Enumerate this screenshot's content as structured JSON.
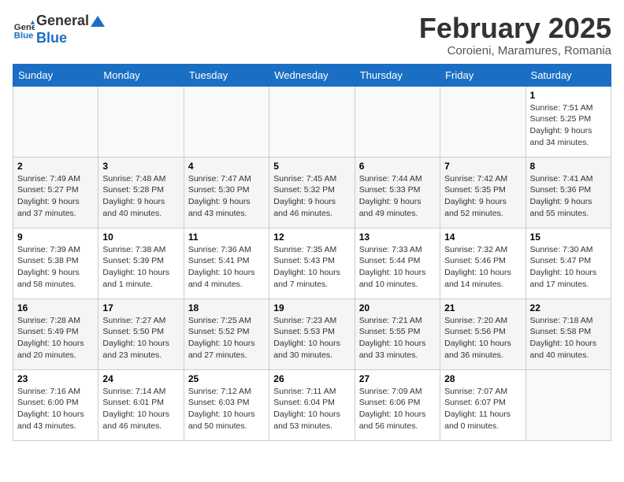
{
  "header": {
    "logo_general": "General",
    "logo_blue": "Blue",
    "month_title": "February 2025",
    "subtitle": "Coroieni, Maramures, Romania"
  },
  "days_of_week": [
    "Sunday",
    "Monday",
    "Tuesday",
    "Wednesday",
    "Thursday",
    "Friday",
    "Saturday"
  ],
  "weeks": [
    [
      {
        "day": "",
        "info": ""
      },
      {
        "day": "",
        "info": ""
      },
      {
        "day": "",
        "info": ""
      },
      {
        "day": "",
        "info": ""
      },
      {
        "day": "",
        "info": ""
      },
      {
        "day": "",
        "info": ""
      },
      {
        "day": "1",
        "info": "Sunrise: 7:51 AM\nSunset: 5:25 PM\nDaylight: 9 hours\nand 34 minutes."
      }
    ],
    [
      {
        "day": "2",
        "info": "Sunrise: 7:49 AM\nSunset: 5:27 PM\nDaylight: 9 hours\nand 37 minutes."
      },
      {
        "day": "3",
        "info": "Sunrise: 7:48 AM\nSunset: 5:28 PM\nDaylight: 9 hours\nand 40 minutes."
      },
      {
        "day": "4",
        "info": "Sunrise: 7:47 AM\nSunset: 5:30 PM\nDaylight: 9 hours\nand 43 minutes."
      },
      {
        "day": "5",
        "info": "Sunrise: 7:45 AM\nSunset: 5:32 PM\nDaylight: 9 hours\nand 46 minutes."
      },
      {
        "day": "6",
        "info": "Sunrise: 7:44 AM\nSunset: 5:33 PM\nDaylight: 9 hours\nand 49 minutes."
      },
      {
        "day": "7",
        "info": "Sunrise: 7:42 AM\nSunset: 5:35 PM\nDaylight: 9 hours\nand 52 minutes."
      },
      {
        "day": "8",
        "info": "Sunrise: 7:41 AM\nSunset: 5:36 PM\nDaylight: 9 hours\nand 55 minutes."
      }
    ],
    [
      {
        "day": "9",
        "info": "Sunrise: 7:39 AM\nSunset: 5:38 PM\nDaylight: 9 hours\nand 58 minutes."
      },
      {
        "day": "10",
        "info": "Sunrise: 7:38 AM\nSunset: 5:39 PM\nDaylight: 10 hours\nand 1 minute."
      },
      {
        "day": "11",
        "info": "Sunrise: 7:36 AM\nSunset: 5:41 PM\nDaylight: 10 hours\nand 4 minutes."
      },
      {
        "day": "12",
        "info": "Sunrise: 7:35 AM\nSunset: 5:43 PM\nDaylight: 10 hours\nand 7 minutes."
      },
      {
        "day": "13",
        "info": "Sunrise: 7:33 AM\nSunset: 5:44 PM\nDaylight: 10 hours\nand 10 minutes."
      },
      {
        "day": "14",
        "info": "Sunrise: 7:32 AM\nSunset: 5:46 PM\nDaylight: 10 hours\nand 14 minutes."
      },
      {
        "day": "15",
        "info": "Sunrise: 7:30 AM\nSunset: 5:47 PM\nDaylight: 10 hours\nand 17 minutes."
      }
    ],
    [
      {
        "day": "16",
        "info": "Sunrise: 7:28 AM\nSunset: 5:49 PM\nDaylight: 10 hours\nand 20 minutes."
      },
      {
        "day": "17",
        "info": "Sunrise: 7:27 AM\nSunset: 5:50 PM\nDaylight: 10 hours\nand 23 minutes."
      },
      {
        "day": "18",
        "info": "Sunrise: 7:25 AM\nSunset: 5:52 PM\nDaylight: 10 hours\nand 27 minutes."
      },
      {
        "day": "19",
        "info": "Sunrise: 7:23 AM\nSunset: 5:53 PM\nDaylight: 10 hours\nand 30 minutes."
      },
      {
        "day": "20",
        "info": "Sunrise: 7:21 AM\nSunset: 5:55 PM\nDaylight: 10 hours\nand 33 minutes."
      },
      {
        "day": "21",
        "info": "Sunrise: 7:20 AM\nSunset: 5:56 PM\nDaylight: 10 hours\nand 36 minutes."
      },
      {
        "day": "22",
        "info": "Sunrise: 7:18 AM\nSunset: 5:58 PM\nDaylight: 10 hours\nand 40 minutes."
      }
    ],
    [
      {
        "day": "23",
        "info": "Sunrise: 7:16 AM\nSunset: 6:00 PM\nDaylight: 10 hours\nand 43 minutes."
      },
      {
        "day": "24",
        "info": "Sunrise: 7:14 AM\nSunset: 6:01 PM\nDaylight: 10 hours\nand 46 minutes."
      },
      {
        "day": "25",
        "info": "Sunrise: 7:12 AM\nSunset: 6:03 PM\nDaylight: 10 hours\nand 50 minutes."
      },
      {
        "day": "26",
        "info": "Sunrise: 7:11 AM\nSunset: 6:04 PM\nDaylight: 10 hours\nand 53 minutes."
      },
      {
        "day": "27",
        "info": "Sunrise: 7:09 AM\nSunset: 6:06 PM\nDaylight: 10 hours\nand 56 minutes."
      },
      {
        "day": "28",
        "info": "Sunrise: 7:07 AM\nSunset: 6:07 PM\nDaylight: 11 hours\nand 0 minutes."
      },
      {
        "day": "",
        "info": ""
      }
    ]
  ]
}
